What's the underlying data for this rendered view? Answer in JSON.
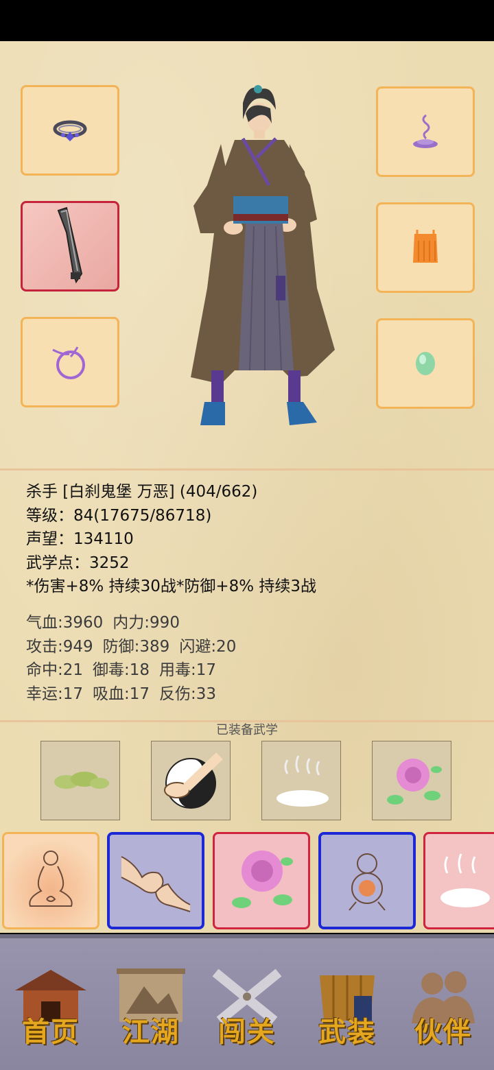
{
  "character": {
    "title_line": "杀手 [白刹鬼堡 万恶] (404/662)",
    "level_line": "等级：84(17675/86718)",
    "reputation_line": "声望：134110",
    "martial_points_line": "武学点：3252",
    "buff_line": "*伤害+8% 持续30战*防御+8% 持续3战"
  },
  "stats": [
    [
      "气血:3960",
      "内力:990"
    ],
    [
      "攻击:949",
      "防御:389",
      "闪避:20"
    ],
    [
      "命中:21",
      "御毒:18",
      "用毒:17"
    ],
    [
      "幸运:17",
      "吸血:17",
      "反伤:33"
    ]
  ],
  "equipped_label": "已装备武学",
  "nav": {
    "home": "首页",
    "jianghu": "江湖",
    "chuangguan": "闯关",
    "wuzhuang": "武装",
    "huoban": "伙伴"
  },
  "colors": {
    "parchment": "#ecdcb2",
    "slot_border": "#f3b357",
    "active_border": "#c5233b",
    "blue_card": "#1c28d6",
    "nav_label": "#e4a71f"
  },
  "icons": {
    "slot_left_1": "ring-icon",
    "slot_left_2": "broadsword-icon",
    "slot_left_3": "bracelet-icon",
    "slot_right_1": "incense-icon",
    "slot_right_2": "robe-icon",
    "slot_right_3": "jade-icon"
  }
}
